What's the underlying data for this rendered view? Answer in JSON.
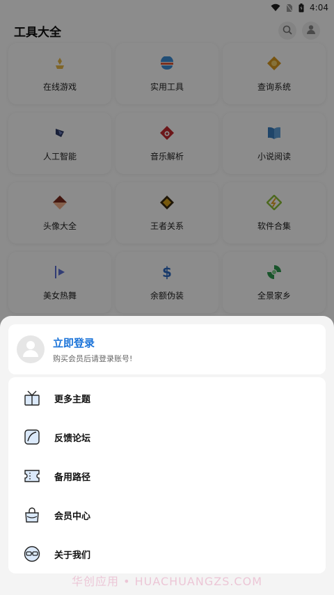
{
  "status_bar": {
    "time": "4:04"
  },
  "app_bar": {
    "title": "工具大全"
  },
  "tiles": [
    {
      "label": "在线游戏",
      "icon": "game-icon",
      "color": "#e8b84a"
    },
    {
      "label": "实用工具",
      "icon": "toolbox-icon",
      "color": "#3d8fd8"
    },
    {
      "label": "查询系统",
      "icon": "query-icon",
      "color": "#d99a1f"
    },
    {
      "label": "人工智能",
      "icon": "ai-icon",
      "color": "#2f3b66"
    },
    {
      "label": "音乐解析",
      "icon": "music-icon",
      "color": "#c5282f"
    },
    {
      "label": "小说阅读",
      "icon": "book-icon",
      "color": "#3a7fbf"
    },
    {
      "label": "头像大全",
      "icon": "avatar-icon",
      "color": "#e25d4e"
    },
    {
      "label": "王者关系",
      "icon": "king-icon",
      "color": "#d9a21b"
    },
    {
      "label": "软件合集",
      "icon": "software-icon",
      "color": "#8cbf3a"
    },
    {
      "label": "美女热舞",
      "icon": "video-icon",
      "color": "#5b6fd6"
    },
    {
      "label": "余额伪装",
      "icon": "dollar-icon",
      "color": "#2d6ac4"
    },
    {
      "label": "全景家乡",
      "icon": "panorama-icon",
      "color": "#2e9a4f"
    }
  ],
  "sheet": {
    "login_title": "立即登录",
    "login_subtitle": "购买会员后请登录账号!",
    "menu": [
      {
        "label": "更多主题",
        "icon": "gift-icon"
      },
      {
        "label": "反馈论坛",
        "icon": "feedback-icon"
      },
      {
        "label": "备用路径",
        "icon": "ticket-icon"
      },
      {
        "label": "会员中心",
        "icon": "bag-icon"
      },
      {
        "label": "关于我们",
        "icon": "glasses-icon"
      }
    ]
  },
  "watermark": "华创应用 • HUACHUANGZS.COM"
}
